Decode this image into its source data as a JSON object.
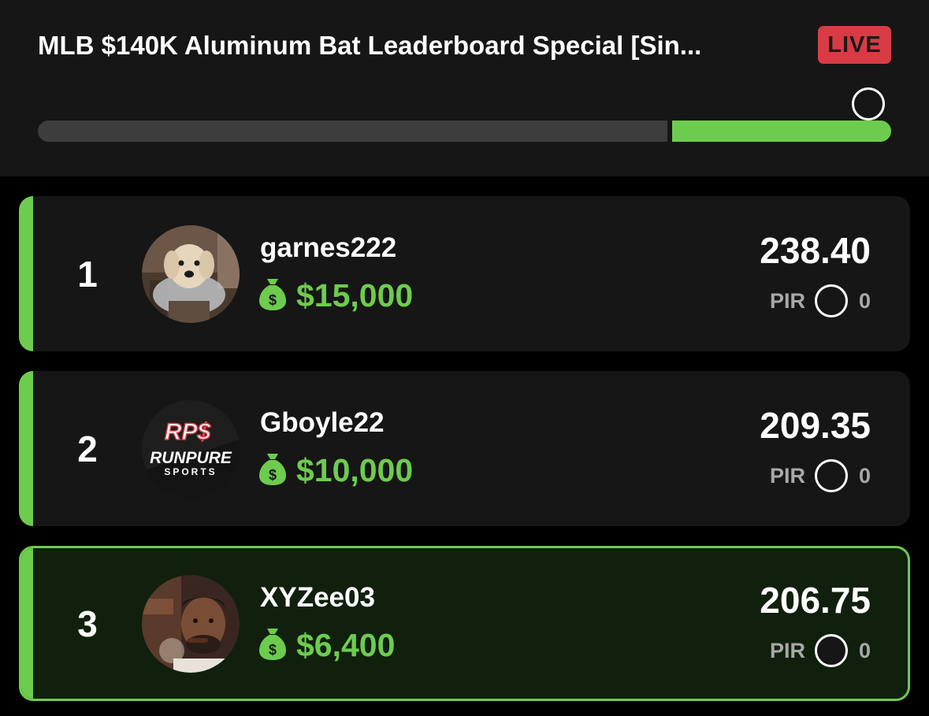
{
  "header": {
    "title": "MLB $140K Aluminum Bat Leaderboard Special [Sin...",
    "live_label": "LIVE",
    "progress": 0.74
  },
  "colors": {
    "accent": "#6dcc4e",
    "live": "#d93b45",
    "card": "#161616",
    "highlight_card": "#10200d"
  },
  "leaderboard": [
    {
      "rank": "1",
      "username": "garnes222",
      "prize": "$15,000",
      "score": "238.40",
      "pir_label": "PIR",
      "pir_value": "0",
      "avatar_icon": "dog-photo-icon"
    },
    {
      "rank": "2",
      "username": "Gboyle22",
      "prize": "$10,000",
      "score": "209.35",
      "pir_label": "PIR",
      "pir_value": "0",
      "avatar_icon": "runpure-sports-logo-icon"
    },
    {
      "rank": "3",
      "username": "XYZee03",
      "prize": "$6,400",
      "score": "206.75",
      "pir_label": "PIR",
      "pir_value": "0",
      "avatar_icon": "person-photo-icon"
    }
  ],
  "logos": {
    "rps_logo_top": "RP$",
    "rps_logo_mid": "RUNPURE",
    "rps_logo_bottom": "SPORTS"
  }
}
